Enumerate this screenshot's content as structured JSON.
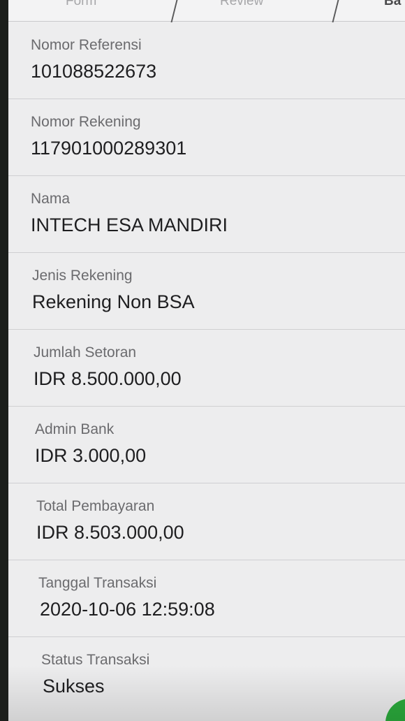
{
  "stepper": {
    "steps": [
      {
        "label": "Form"
      },
      {
        "label": "Review"
      },
      {
        "label": "Ba"
      }
    ]
  },
  "details": [
    {
      "label": "Nomor Referensi",
      "value": "101088522673"
    },
    {
      "label": "Nomor Rekening",
      "value": "117901000289301"
    },
    {
      "label": "Nama",
      "value": "INTECH ESA MANDIRI"
    },
    {
      "label": "Jenis Rekening",
      "value": "Rekening Non BSA"
    },
    {
      "label": "Jumlah Setoran",
      "value": "IDR 8.500.000,00"
    },
    {
      "label": "Admin Bank",
      "value": "IDR 3.000,00"
    },
    {
      "label": "Total Pembayaran",
      "value": "IDR 8.503.000,00"
    },
    {
      "label": "Tanggal Transaksi",
      "value": "2020-10-06 12:59:08"
    },
    {
      "label": "Status Transaksi",
      "value": "Sukses"
    }
  ],
  "colors": {
    "background": "#ededee",
    "accent_green": "#2bab3c"
  }
}
